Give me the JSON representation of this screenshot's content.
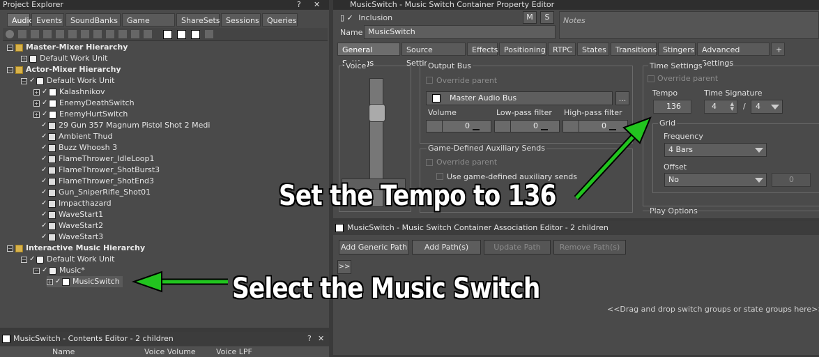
{
  "project_explorer": {
    "title": "Project Explorer",
    "tabs": [
      "Audio",
      "Events",
      "SoundBanks",
      "Game Syncs",
      "ShareSets",
      "Sessions",
      "Queries"
    ],
    "tree": {
      "master_mixer": "Master-Mixer Hierarchy",
      "mm_wu": "Default Work Unit",
      "actor_mixer": "Actor-Mixer Hierarchy",
      "am_wu": "Default Work Unit",
      "am_items": [
        "Kalashnikov",
        "EnemyDeathSwitch",
        "EnemyHurtSwitch",
        "29 Gun 357 Magnum Pistol Shot 2 Medi",
        "Ambient Thud",
        "Buzz Whoosh 3",
        "FlameThrower_IdleLoop1",
        "FlameThrower_ShotBurst3",
        "FlameThrower_ShotEnd3",
        "Gun_SniperRifle_Shot01",
        "Impacthazard",
        "WaveStart1",
        "WaveStart2",
        "WaveStart3"
      ],
      "interactive_music": "Interactive Music Hierarchy",
      "im_wu": "Default Work Unit",
      "music": "Music*",
      "music_switch": "MusicSwitch"
    }
  },
  "contents_editor": {
    "title": "MusicSwitch - Contents Editor - 2 children",
    "help": "?",
    "close": "✕",
    "columns": [
      "Name",
      "Voice Volume",
      "Voice LPF"
    ]
  },
  "property_editor": {
    "title": "MusicSwitch - Music Switch Container Property Editor",
    "inclusion": "Inclusion",
    "m": "M",
    "s": "S",
    "notes": "Notes",
    "name_label": "Name",
    "name_value": "MusicSwitch",
    "tabs": [
      "General Settings",
      "Source Settings",
      "Effects",
      "Positioning",
      "RTPC",
      "States",
      "Transitions",
      "Stingers",
      "Advanced Settings",
      "+"
    ],
    "voice_label": "Voice",
    "output_bus": {
      "group": "Output Bus",
      "override": "Override parent",
      "bus": "Master Audio Bus",
      "browse": "...",
      "volume": "Volume",
      "lowpass": "Low-pass filter",
      "highpass": "High-pass filter",
      "vol_val": "0",
      "lp_val": "0",
      "hp_val": "0"
    },
    "aux": {
      "group": "Game-Defined Auxiliary Sends",
      "override": "Override parent",
      "use": "Use game-defined auxiliary sends"
    },
    "time": {
      "group": "Time Settings",
      "override": "Override parent",
      "tempo_label": "Tempo",
      "tempo": "136",
      "sig_label": "Time Signature",
      "sig_num": "4",
      "slash": "/",
      "sig_den": "4",
      "grid": "Grid",
      "freq_label": "Frequency",
      "freq": "4 Bars",
      "offset_label": "Offset",
      "offset": "No",
      "offset_val": "0"
    },
    "play_options": "Play Options"
  },
  "assoc_editor": {
    "title": "MusicSwitch - Music Switch Container Association Editor - 2 children",
    "add_generic": "Add Generic Path",
    "add_paths": "Add Path(s)",
    "update_path": "Update Path",
    "remove_paths": "Remove Path(s)",
    "expand": ">>",
    "drop_hint": "<<Drag and drop switch groups or state groups here>>"
  },
  "annotations": {
    "tempo_note": "Set the Tempo to 136",
    "select_note": "Select the Music Switch",
    "arrow_color": "#22c41f"
  }
}
